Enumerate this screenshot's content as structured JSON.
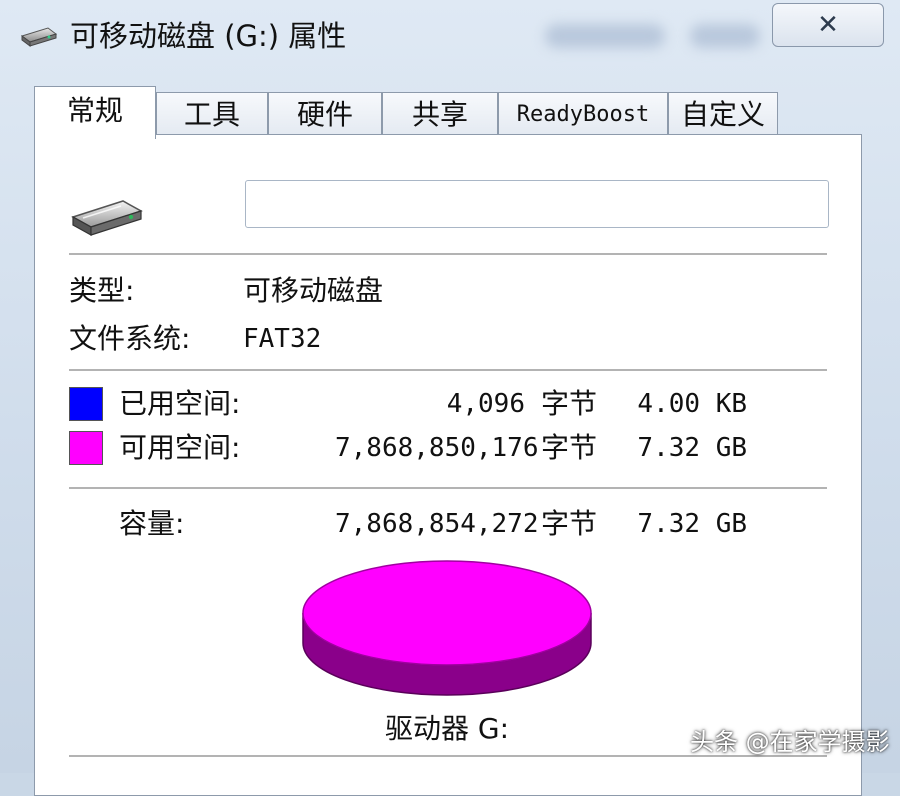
{
  "window": {
    "title": "可移动磁盘 (G:) 属性",
    "close_glyph": "✕"
  },
  "tabs": [
    {
      "label": "常规",
      "active": true
    },
    {
      "label": "工具",
      "active": false
    },
    {
      "label": "硬件",
      "active": false
    },
    {
      "label": "共享",
      "active": false
    },
    {
      "label": "ReadyBoost",
      "active": false
    },
    {
      "label": "自定义",
      "active": false
    }
  ],
  "general": {
    "drive_icon": "removable-drive-icon",
    "name_value": "",
    "type_label": "类型:",
    "type_value": "可移动磁盘",
    "fs_label": "文件系统:",
    "fs_value": "FAT32",
    "used": {
      "label": "已用空间:",
      "bytes": "4,096",
      "unit": "字节",
      "size": "4.00 KB",
      "color": "#0000ff"
    },
    "free": {
      "label": "可用空间:",
      "bytes": "7,868,850,176",
      "unit": "字节",
      "size": "7.32 GB",
      "color": "#ff00ff"
    },
    "capacity": {
      "label": "容量:",
      "bytes": "7,868,854,272",
      "unit": "字节",
      "size": "7.32 GB"
    },
    "drive_label": "驱动器 G:"
  },
  "watermark": "头条 @在家学摄影"
}
